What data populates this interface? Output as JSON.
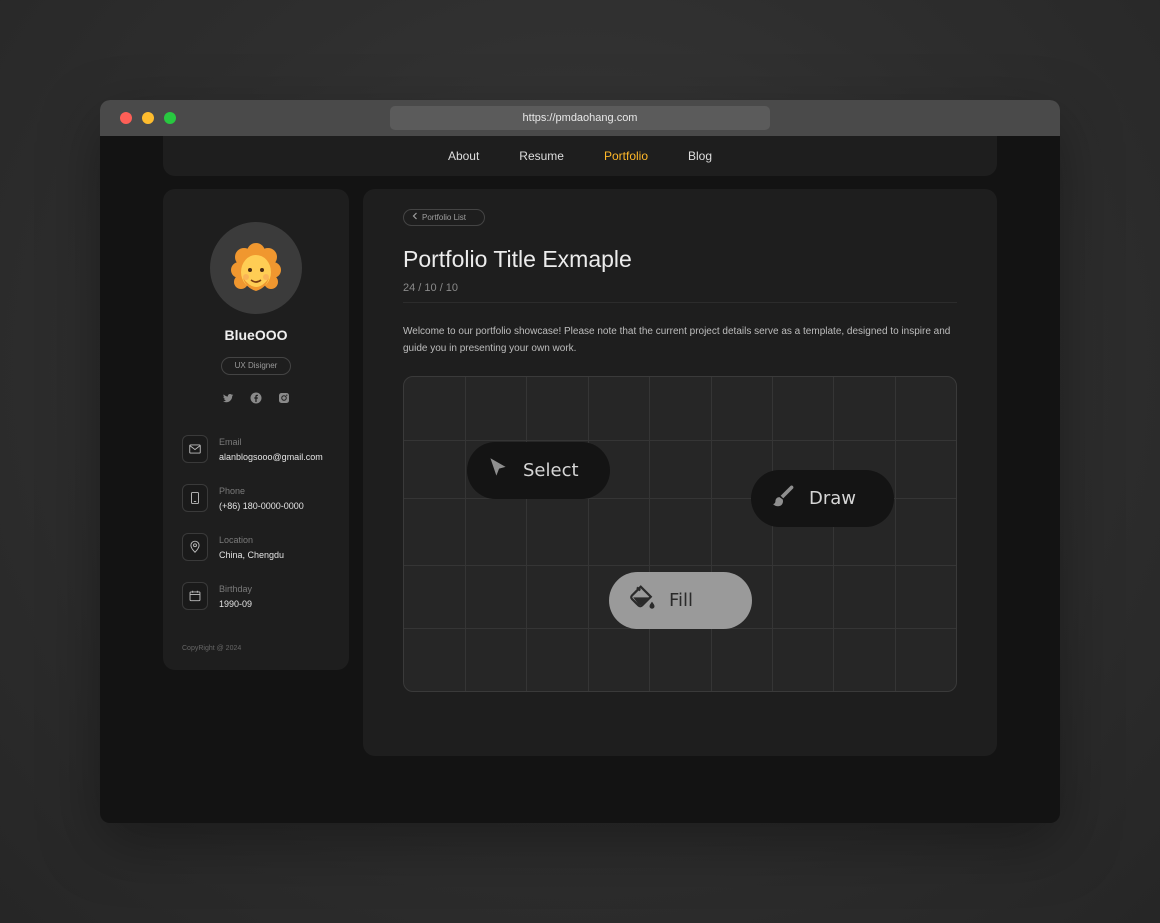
{
  "browser": {
    "url": "https://pmdaohang.com"
  },
  "nav": {
    "items": [
      {
        "label": "About"
      },
      {
        "label": "Resume"
      },
      {
        "label": "Portfolio"
      },
      {
        "label": "Blog"
      }
    ],
    "active": "Portfolio"
  },
  "profile": {
    "avatar_emoji": "🧑‍🦰",
    "name": "BlueOOO",
    "role": "UX Disigner",
    "socials": [
      "twitter-icon",
      "facebook-icon",
      "instagram-icon"
    ],
    "contacts": [
      {
        "icon": "mail-icon",
        "label": "Email",
        "value": "alanblogsooo@gmail.com"
      },
      {
        "icon": "phone-icon",
        "label": "Phone",
        "value": "(+86) 180-0000-0000"
      },
      {
        "icon": "location-icon",
        "label": "Location",
        "value": "China, Chengdu"
      },
      {
        "icon": "calendar-icon",
        "label": "Birthday",
        "value": "1990-09"
      }
    ],
    "copyright": "CopyRight @ 2024"
  },
  "post": {
    "back_label": "Portfolio List",
    "title": "Portfolio Title Exmaple",
    "date": "24 / 10 / 10",
    "body": "Welcome to our portfolio showcase! Please note that the current project details serve as a template, designed to inspire and guide you in presenting your own work."
  },
  "canvas": {
    "tools": [
      {
        "label": "Select",
        "icon": "cursor-icon"
      },
      {
        "label": "Draw",
        "icon": "brush-icon"
      },
      {
        "label": "Fill",
        "icon": "paint-bucket-icon"
      }
    ]
  },
  "colors": {
    "accent": "#ffb829",
    "background": "#131313",
    "card": "#1e1e1e"
  }
}
